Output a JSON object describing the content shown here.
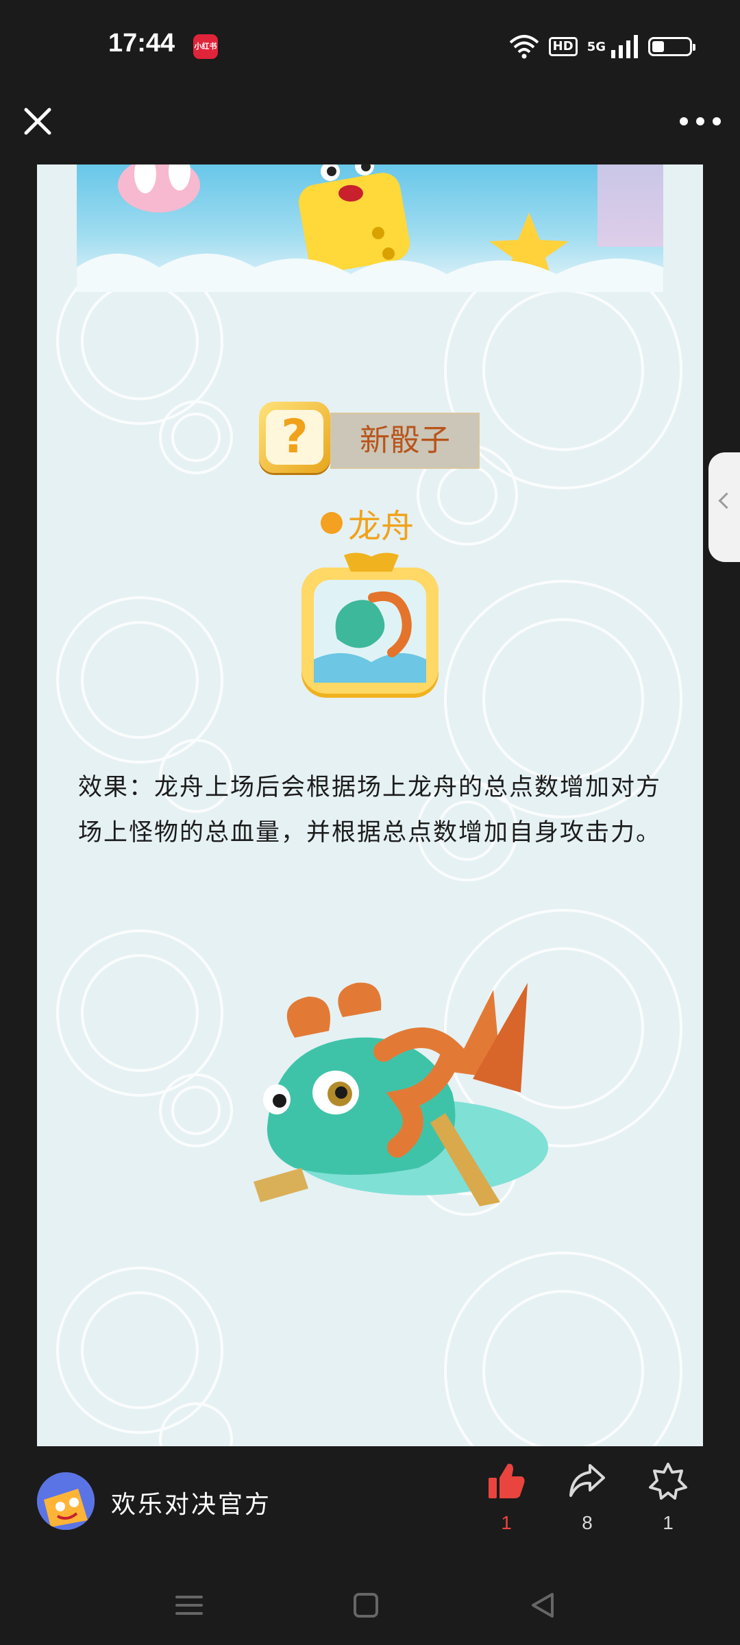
{
  "status_bar": {
    "time": "17:44",
    "app_badge": "小红书",
    "hd": "HD",
    "network": "5G",
    "battery_level": 0.3
  },
  "content": {
    "section_title": "新骰子",
    "dice_name": "龙舟",
    "effect": "效果：龙舟上场后会根据场上龙舟的总点数增加对方场上怪物的总血量，并根据总点数增加自身攻击力。"
  },
  "author": {
    "name": "欢乐对决官方"
  },
  "actions": {
    "likes": "1",
    "shares": "8",
    "collects": "1"
  },
  "colors": {
    "background": "#1b1b1b",
    "content_bg": "#e6f1f3",
    "like_active": "#e9453e",
    "accent_orange": "#f0a21a"
  }
}
